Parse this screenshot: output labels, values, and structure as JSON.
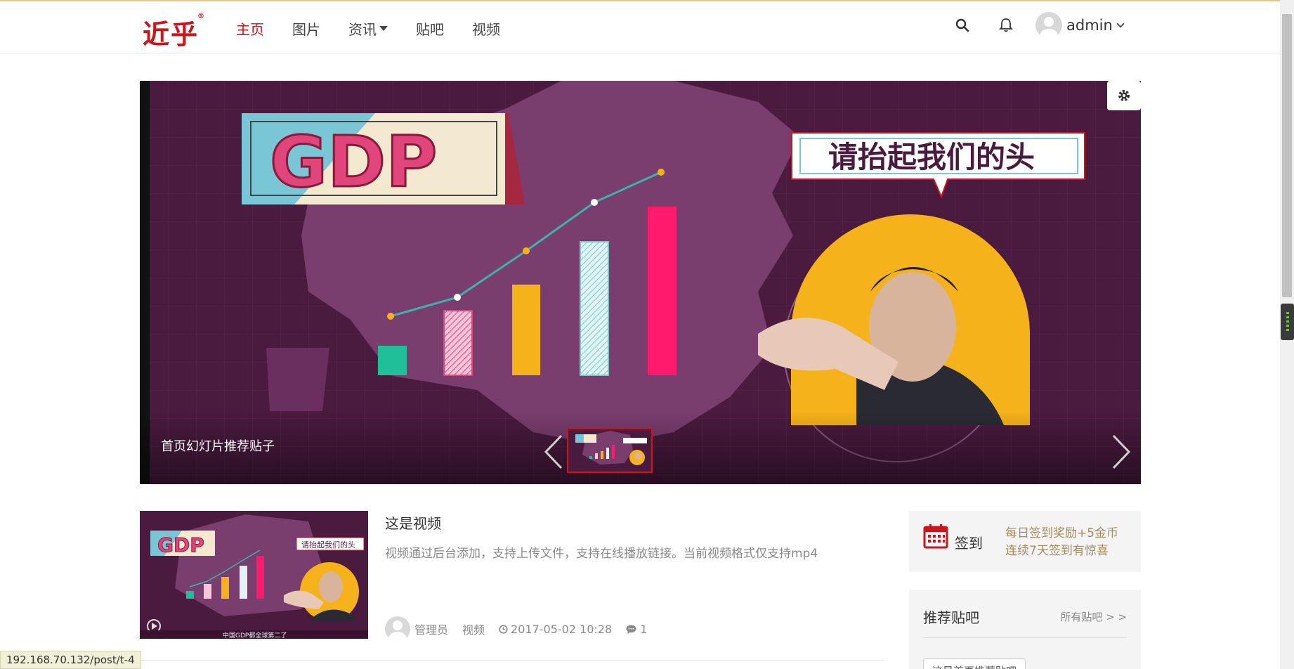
{
  "header": {
    "logo_text": "近乎",
    "logo_mark": "®",
    "nav": [
      {
        "label": "主页",
        "active": true
      },
      {
        "label": "图片",
        "active": false
      },
      {
        "label": "资讯",
        "active": false,
        "has_dropdown": true
      },
      {
        "label": "贴吧",
        "active": false
      },
      {
        "label": "视频",
        "active": false
      }
    ],
    "search_icon": "search-icon",
    "bell_icon": "bell-icon",
    "user_name": "admin"
  },
  "slider": {
    "caption": "首页幻灯片推荐贴子",
    "gdp_text": "GDP",
    "speech_text": "请抬起我们的头",
    "thumb_caption": "中国GDP都全球第二了"
  },
  "post": {
    "title": "这是视频",
    "description": "视频通过后台添加，支持上传文件，支持在线播放链接。当前视频格式仅支持mp4",
    "author": "管理员",
    "category": "视频",
    "datetime": "2017-05-02 10:28",
    "comments": "1",
    "thumb_caption": "中国GDP都全球第二了"
  },
  "sidebar": {
    "checkin_label": "签到",
    "checkin_line1": "每日签到奖励+5金币",
    "checkin_line2": "连续7天签到有惊喜",
    "recommend_title": "推荐贴吧",
    "recommend_more": "所有贴吧 > >",
    "recommend_item": "这是首页推荐贴吧"
  },
  "status_url": "192.168.70.132/post/t-4",
  "colors": {
    "brand": "#c8161d",
    "slide_bg": "#4a1a3f",
    "checkin_text": "#a68b5b"
  }
}
